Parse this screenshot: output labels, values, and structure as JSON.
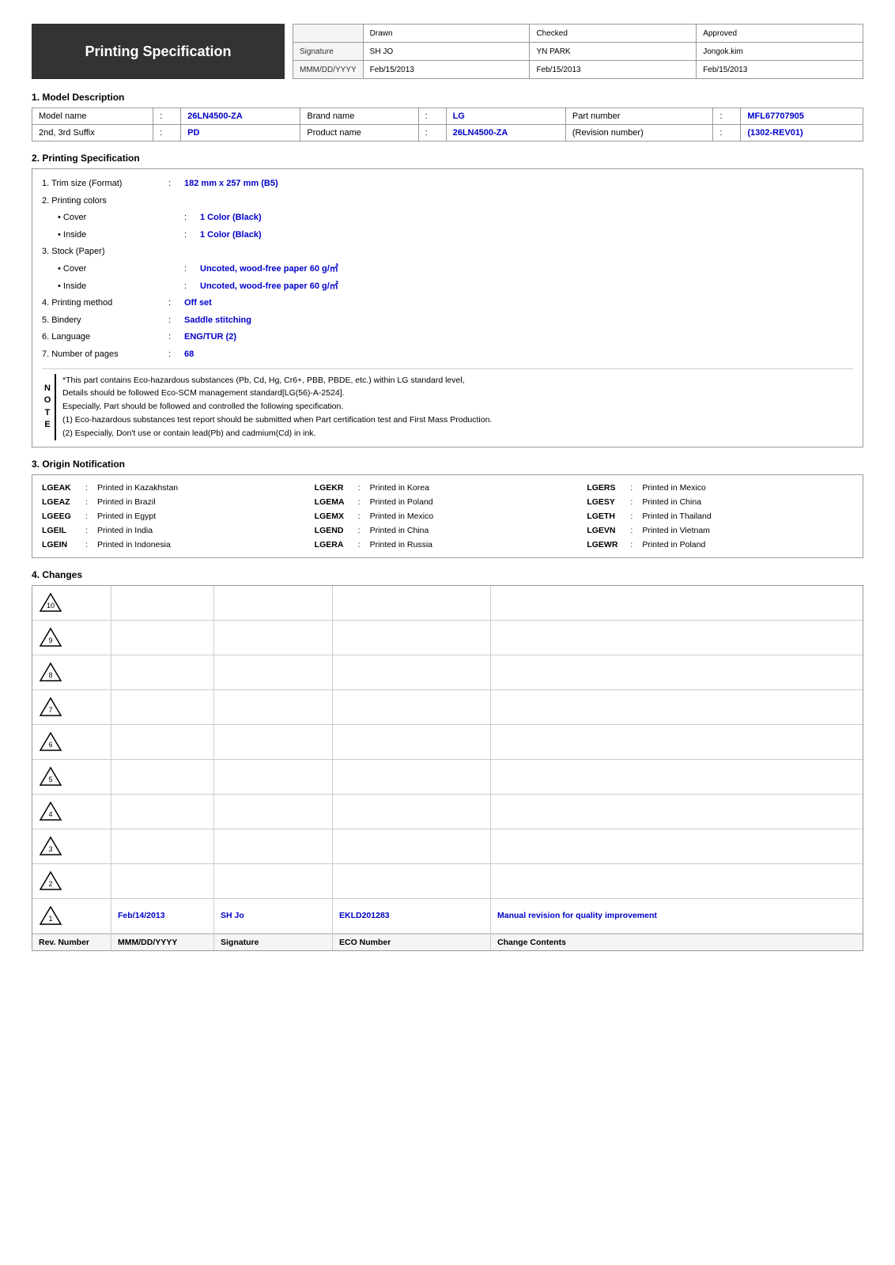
{
  "header": {
    "title": "Printing Specification",
    "approval_rows": [
      {
        "label": "",
        "drawn": "Drawn",
        "checked": "Checked",
        "approved": "Approved"
      },
      {
        "label": "Signature",
        "drawn": "SH JO",
        "checked": "YN PARK",
        "approved": "Jongok.kim"
      },
      {
        "label": "MMM/DD/YYYY",
        "drawn": "Feb/15/2013",
        "checked": "Feb/15/2013",
        "approved": "Feb/15/2013"
      }
    ]
  },
  "sections": {
    "model_description": {
      "title": "1. Model Description",
      "rows": [
        {
          "col1_label": "Model name",
          "col1_colon": ":",
          "col1_value": "26LN4500-ZA",
          "col2_label": "Brand name",
          "col2_colon": ":",
          "col2_value": "LG",
          "col3_label": "Part number",
          "col3_colon": ":",
          "col3_value": "MFL67707905"
        },
        {
          "col1_label": "2nd, 3rd Suffix",
          "col1_colon": ":",
          "col1_value": "PD",
          "col2_label": "Product name",
          "col2_colon": ":",
          "col2_value": "26LN4500-ZA",
          "col3_label": "(Revision number)",
          "col3_colon": ":",
          "col3_value": "(1302-REV01)"
        }
      ]
    },
    "printing_spec": {
      "title": "2. Printing Specification",
      "items": [
        {
          "indent": 0,
          "label": "1. Trim size (Format)",
          "colon": ":",
          "value": "182 mm x 257 mm (B5)",
          "type": "spec"
        },
        {
          "indent": 0,
          "label": "2. Printing colors",
          "colon": "",
          "value": "",
          "type": "heading"
        },
        {
          "indent": 1,
          "label": "• Cover",
          "colon": ":",
          "value": "1 Color (Black)",
          "type": "spec"
        },
        {
          "indent": 1,
          "label": "• Inside",
          "colon": ":",
          "value": "1 Color (Black)",
          "type": "spec"
        },
        {
          "indent": 0,
          "label": "3. Stock (Paper)",
          "colon": "",
          "value": "",
          "type": "heading"
        },
        {
          "indent": 1,
          "label": "• Cover",
          "colon": ":",
          "value": "Uncoted, wood-free paper 60 g/㎡",
          "type": "spec"
        },
        {
          "indent": 1,
          "label": "• Inside",
          "colon": ":",
          "value": "Uncoted, wood-free paper 60 g/㎡",
          "type": "spec"
        },
        {
          "indent": 0,
          "label": "4. Printing method",
          "colon": ":",
          "value": "Off set",
          "type": "spec"
        },
        {
          "indent": 0,
          "label": "5. Bindery",
          "colon": ":",
          "value": "Saddle stitching",
          "type": "spec"
        },
        {
          "indent": 0,
          "label": "6. Language",
          "colon": ":",
          "value": "ENG/TUR (2)",
          "type": "spec"
        },
        {
          "indent": 0,
          "label": "7. Number of pages",
          "colon": ":",
          "value": "68",
          "type": "spec"
        }
      ],
      "notes": [
        {
          "marker": "",
          "text": "*This part contains Eco-hazardous substances (Pb, Cd, Hg, Cr6+, PBB, PBDE, etc.) within LG standard level,"
        },
        {
          "marker": "",
          "text": "Details should be followed Eco-SCM management standard[LG(56)-A-2524]."
        },
        {
          "marker": "",
          "text": "Especially, Part should be followed and controlled the following specification."
        },
        {
          "marker": "",
          "text": "(1) Eco-hazardous substances test report should be submitted when Part certification test and First Mass Production."
        },
        {
          "marker": "",
          "text": "(2) Especially, Don't use or contain lead(Pb) and cadmium(Cd) in ink."
        }
      ],
      "note_label": "NOTE"
    },
    "origin": {
      "title": "3. Origin Notification",
      "items": [
        {
          "code": "LGEAK",
          "sep": ":",
          "desc": "Printed in Kazakhstan"
        },
        {
          "code": "LGEKR",
          "sep": ":",
          "desc": "Printed in Korea"
        },
        {
          "code": "LGERS",
          "sep": ":",
          "desc": "Printed in Mexico"
        },
        {
          "code": "LGEAZ",
          "sep": ":",
          "desc": "Printed in Brazil"
        },
        {
          "code": "LGEMA",
          "sep": ":",
          "desc": "Printed in Poland"
        },
        {
          "code": "LGESY",
          "sep": ":",
          "desc": "Printed in China"
        },
        {
          "code": "LGEEG",
          "sep": ":",
          "desc": "Printed in Egypt"
        },
        {
          "code": "LGEMX",
          "sep": ":",
          "desc": "Printed in Mexico"
        },
        {
          "code": "LGETH",
          "sep": ":",
          "desc": "Printed in Thailand"
        },
        {
          "code": "LGEIL",
          "sep": ":",
          "desc": "Printed in India"
        },
        {
          "code": "LGEND",
          "sep": ":",
          "desc": "Printed in China"
        },
        {
          "code": "LGEVN",
          "sep": ":",
          "desc": "Printed in Vietnam"
        },
        {
          "code": "LGEIN",
          "sep": ":",
          "desc": "Printed in Indonesia"
        },
        {
          "code": "LGERA",
          "sep": ":",
          "desc": "Printed in Russia"
        },
        {
          "code": "LGEWR",
          "sep": ":",
          "desc": "Printed in Poland"
        }
      ]
    },
    "changes": {
      "title": "4. Changes",
      "data_rows": [
        {
          "rev": "10",
          "date": "",
          "signature": "",
          "eco": "",
          "contents": ""
        },
        {
          "rev": "9",
          "date": "",
          "signature": "",
          "eco": "",
          "contents": ""
        },
        {
          "rev": "8",
          "date": "",
          "signature": "",
          "eco": "",
          "contents": ""
        },
        {
          "rev": "7",
          "date": "",
          "signature": "",
          "eco": "",
          "contents": ""
        },
        {
          "rev": "6",
          "date": "",
          "signature": "",
          "eco": "",
          "contents": ""
        },
        {
          "rev": "5",
          "date": "",
          "signature": "",
          "eco": "",
          "contents": ""
        },
        {
          "rev": "4",
          "date": "",
          "signature": "",
          "eco": "",
          "contents": ""
        },
        {
          "rev": "3",
          "date": "",
          "signature": "",
          "eco": "",
          "contents": ""
        },
        {
          "rev": "2",
          "date": "",
          "signature": "",
          "eco": "",
          "contents": ""
        },
        {
          "rev": "1",
          "date": "Feb/14/2013",
          "signature": "SH Jo",
          "eco": "EKLD201283",
          "contents": "Manual revision for quality improvement"
        }
      ],
      "footer": {
        "rev_label": "Rev. Number",
        "date_label": "MMM/DD/YYYY",
        "sig_label": "Signature",
        "eco_label": "ECO Number",
        "contents_label": "Change Contents"
      }
    }
  }
}
